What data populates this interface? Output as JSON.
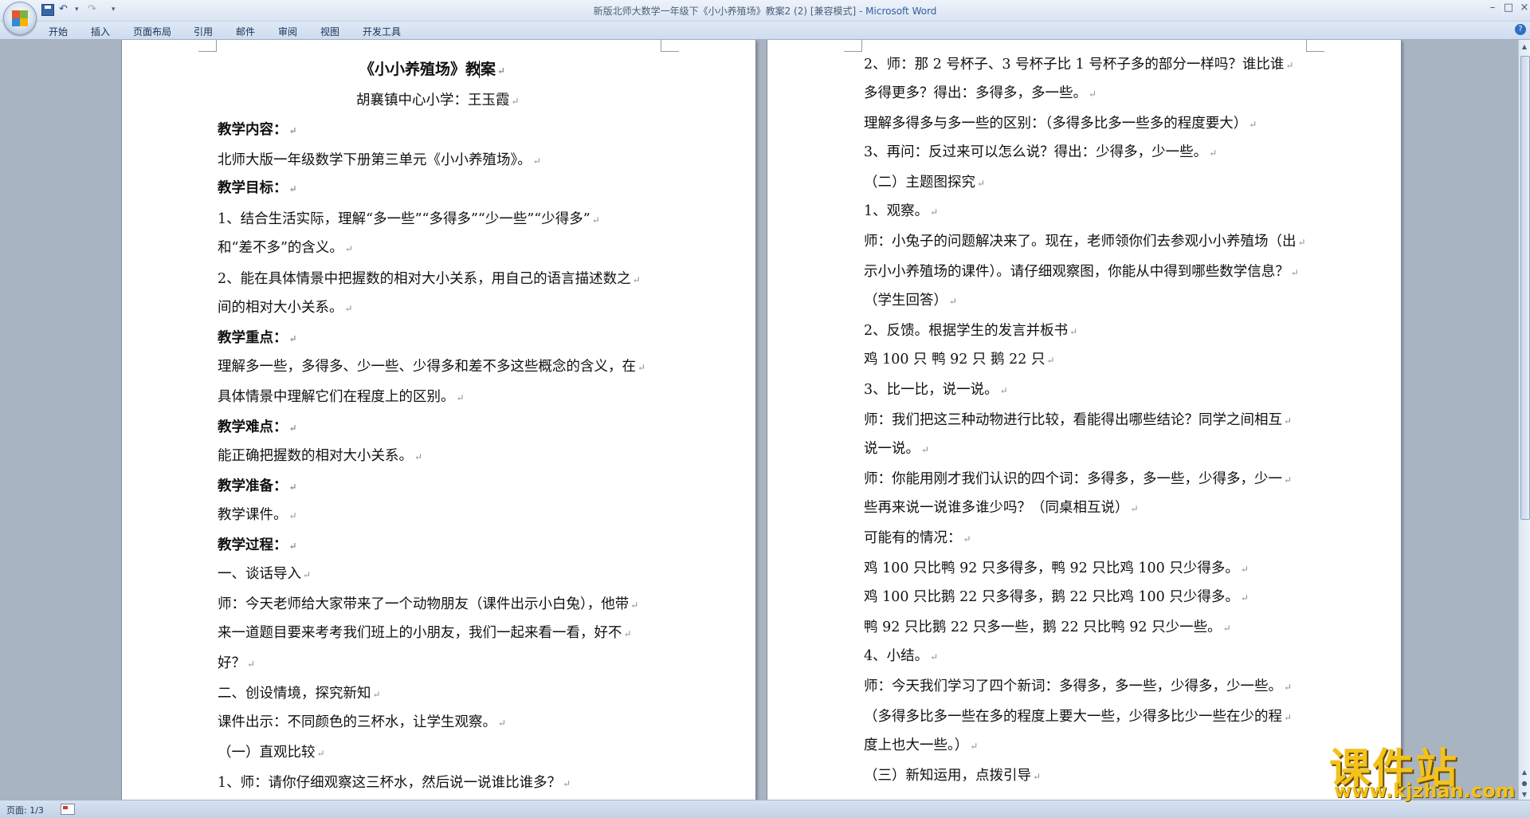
{
  "window": {
    "title_doc": "新版北师大数学一年级下《小小养殖场》教案2 (2) [兼容模式] - ",
    "title_app": "Microsoft Word",
    "minimize": "–",
    "maximize": "□",
    "close": "×"
  },
  "qat": {
    "undo": "↶",
    "undo_drop": "▾",
    "redo": "↷",
    "customize": "▾"
  },
  "ribbon": {
    "tabs": [
      "开始",
      "插入",
      "页面布局",
      "引用",
      "邮件",
      "审阅",
      "视图",
      "开发工具"
    ],
    "help": "?"
  },
  "paragraph_mark": "↵",
  "document": {
    "left_page": [
      {
        "text": "《小小养殖场》教案",
        "style": "title"
      },
      {
        "text": "胡襄镇中心小学：王玉霞",
        "style": "normal"
      },
      {
        "text": "教学内容：",
        "style": "bold"
      },
      {
        "text": "北师大版一年级数学下册第三单元《小小养殖场》。",
        "style": "normal"
      },
      {
        "text": "教学目标：",
        "style": "bold"
      },
      {
        "text": "1、结合生活实际，理解“多一些”“多得多”“少一些”“少得多”",
        "style": "normal"
      },
      {
        "text": "和“差不多”的含义。",
        "style": "normal"
      },
      {
        "text": "2、能在具体情景中把握数的相对大小关系，用自己的语言描述数之",
        "style": "normal"
      },
      {
        "text": "间的相对大小关系。",
        "style": "normal"
      },
      {
        "text": "教学重点：",
        "style": "bold"
      },
      {
        "text": "理解多一些，多得多、少一些、少得多和差不多这些概念的含义，在",
        "style": "normal"
      },
      {
        "text": "具体情景中理解它们在程度上的区别。",
        "style": "normal"
      },
      {
        "text": "教学难点：",
        "style": "bold"
      },
      {
        "text": "能正确把握数的相对大小关系。",
        "style": "normal"
      },
      {
        "text": "教学准备：",
        "style": "bold"
      },
      {
        "text": "教学课件。",
        "style": "normal"
      },
      {
        "text": "教学过程：",
        "style": "bold"
      },
      {
        "text": "一、谈话导入",
        "style": "normal"
      },
      {
        "text": "师：今天老师给大家带来了一个动物朋友（课件出示小白兔），他带",
        "style": "normal"
      },
      {
        "text": "来一道题目要来考考我们班上的小朋友，我们一起来看一看，好不",
        "style": "normal"
      },
      {
        "text": "好？",
        "style": "normal"
      },
      {
        "text": "二、创设情境，探究新知",
        "style": "normal"
      },
      {
        "text": "课件出示：不同颜色的三杯水，让学生观察。",
        "style": "normal"
      },
      {
        "text": "（一）直观比较",
        "style": "normal"
      },
      {
        "text": "1、师：请你仔细观察这三杯水，然后说一说谁比谁多？",
        "style": "normal"
      }
    ],
    "right_page": [
      {
        "text": "2、师：那 2 号杯子、3 号杯子比 1 号杯子多的部分一样吗？谁比谁",
        "style": "normal"
      },
      {
        "text": "多得更多？得出：多得多，多一些。",
        "style": "normal"
      },
      {
        "text": "理解多得多与多一些的区别：（多得多比多一些多的程度要大）",
        "style": "normal"
      },
      {
        "text": "3、再问：反过来可以怎么说？得出：少得多，少一些。",
        "style": "normal"
      },
      {
        "text": "（二）主题图探究",
        "style": "normal"
      },
      {
        "text": "1、观察。",
        "style": "normal"
      },
      {
        "text": "师：小兔子的问题解决来了。现在，老师领你们去参观小小养殖场（出",
        "style": "normal"
      },
      {
        "text": "示小小养殖场的课件）。请仔细观察图，你能从中得到哪些数学信息？",
        "style": "normal"
      },
      {
        "text": "（学生回答）",
        "style": "normal"
      },
      {
        "text": "2、反馈。根据学生的发言并板书",
        "style": "normal"
      },
      {
        "text": "鸡 100 只 鸭 92 只        鹅 22 只",
        "style": "normal"
      },
      {
        "text": "3、比一比，说一说。",
        "style": "normal"
      },
      {
        "text": "师：我们把这三种动物进行比较，看能得出哪些结论？同学之间相互",
        "style": "normal"
      },
      {
        "text": "说一说。",
        "style": "normal"
      },
      {
        "text": "师：你能用刚才我们认识的四个词：多得多，多一些，少得多，少一",
        "style": "normal"
      },
      {
        "text": "些再来说一说谁多谁少吗？（同桌相互说）",
        "style": "normal"
      },
      {
        "text": "可能有的情况：",
        "style": "normal"
      },
      {
        "text": "鸡 100 只比鸭 92 只多得多，鸭 92 只比鸡 100 只少得多。",
        "style": "normal"
      },
      {
        "text": "鸡 100 只比鹅 22 只多得多，鹅 22 只比鸡 100 只少得多。",
        "style": "normal"
      },
      {
        "text": "鸭 92 只比鹅 22 只多一些，鹅 22 只比鸭 92 只少一些。",
        "style": "normal"
      },
      {
        "text": "4、小结。",
        "style": "normal"
      },
      {
        "text": "师：今天我们学习了四个新词：多得多，多一些，少得多，少一些。",
        "style": "normal"
      },
      {
        "text": "（多得多比多一些在多的程度上要大一些，少得多比少一些在少的程",
        "style": "normal"
      },
      {
        "text": "度上也大一些。）",
        "style": "normal"
      },
      {
        "text": "（三）新知运用，点拨引导",
        "style": "normal"
      }
    ]
  },
  "statusbar": {
    "page_count": "页面: 1/3"
  },
  "watermark": {
    "text": "课件站",
    "url": "www.kjzhan.com"
  },
  "icons": [
    "office-button-icon",
    "save-icon",
    "undo-icon",
    "redo-icon",
    "help-icon",
    "language-icon"
  ],
  "colors": {
    "workspace": "#a9b4c2",
    "ribbon": "#d9e4f2",
    "title_app": "#2f5d9a",
    "watermark": "#f3c21c"
  }
}
